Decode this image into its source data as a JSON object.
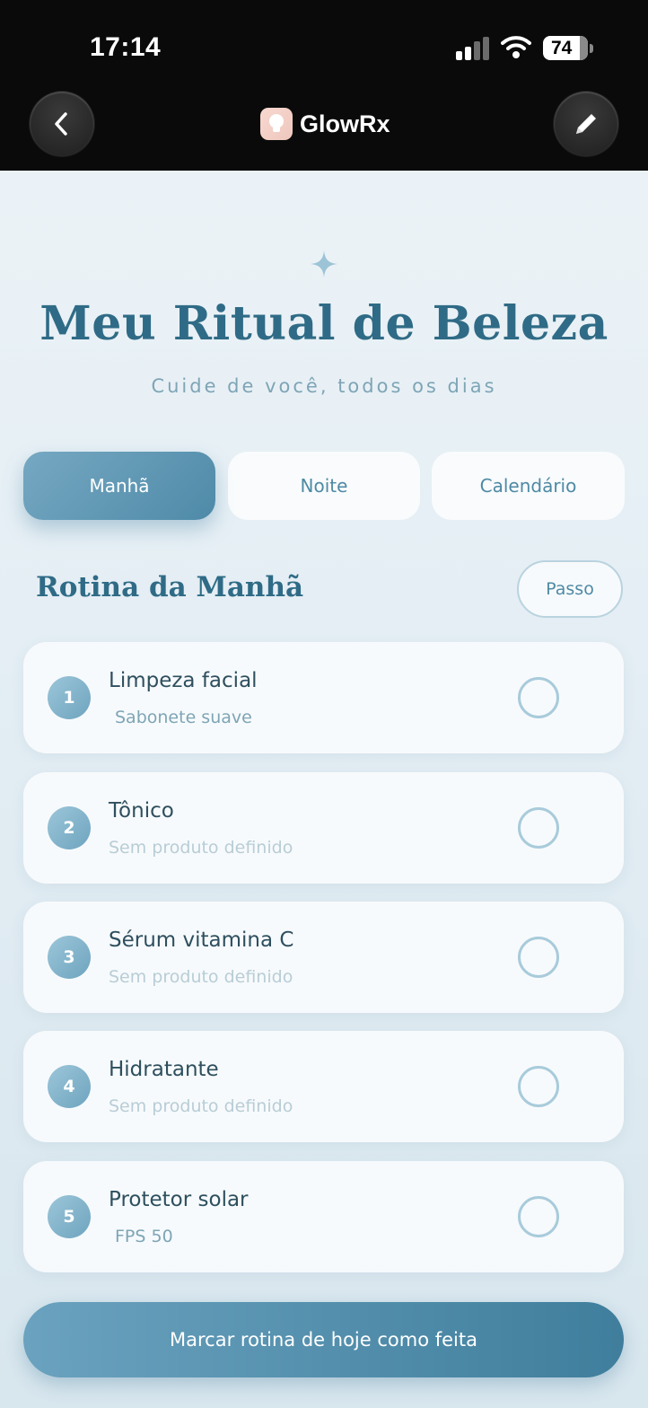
{
  "status_bar": {
    "time": "17:14",
    "battery": "74"
  },
  "header": {
    "app_name": "GlowRx"
  },
  "hero": {
    "title": "Meu Ritual de Beleza",
    "subtitle": "Cuide de você, todos os dias"
  },
  "tabs": [
    {
      "label": "Manhã",
      "active": true
    },
    {
      "label": "Noite",
      "active": false
    },
    {
      "label": "Calendário",
      "active": false
    }
  ],
  "section": {
    "title": "Rotina da Manhã",
    "step_button": "Passo"
  },
  "steps": [
    {
      "number": "1",
      "name": "Limpeza facial",
      "product": "Sabonete suave",
      "product_set": true,
      "done": false
    },
    {
      "number": "2",
      "name": "Tônico",
      "product": "Sem produto definido",
      "product_set": false,
      "done": false
    },
    {
      "number": "3",
      "name": "Sérum vitamina C",
      "product": "Sem produto definido",
      "product_set": false,
      "done": false
    },
    {
      "number": "4",
      "name": "Hidratante",
      "product": "Sem produto definido",
      "product_set": false,
      "done": false
    },
    {
      "number": "5",
      "name": "Protetor solar",
      "product": "FPS 50",
      "product_set": true,
      "done": false
    }
  ],
  "cta": {
    "label": "Marcar rotina de hoje como feita"
  },
  "colors": {
    "accent": "#4e8aa4",
    "title": "#2f6b86",
    "header_bg": "#0a0a0a"
  },
  "icons": {
    "back": "chevron-left-icon",
    "edit": "pencil-icon",
    "logo": "lightbulb-icon",
    "sparkle": "sparkle-icon",
    "signal": "signal-icon",
    "wifi": "wifi-icon"
  }
}
